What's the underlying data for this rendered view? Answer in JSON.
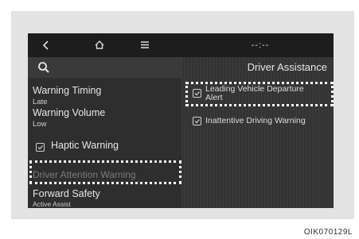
{
  "topbar": {
    "back_icon": "chevron-left-icon",
    "home_icon": "home-icon",
    "menu_icon": "menu-icon",
    "status_text": "--:--"
  },
  "left_menu": {
    "search_icon": "search-icon",
    "items": [
      {
        "title": "Warning Timing",
        "subtitle": "Late"
      },
      {
        "title": "Warning Volume",
        "subtitle": "Low"
      },
      {
        "title": "Haptic Warning",
        "checked": true
      },
      {
        "title": "Driver Attention Warning",
        "dimmed": true
      },
      {
        "title": "Forward Safety",
        "subtitle": "Active Assist"
      }
    ]
  },
  "right_panel": {
    "title": "Driver Assistance",
    "options": [
      {
        "label_line1": "Leading Vehicle Departure",
        "label_line2": "Alert",
        "checked": true
      },
      {
        "label": "Inattentive Driving Warning",
        "checked": true
      }
    ]
  },
  "caption": "OIK070129L"
}
